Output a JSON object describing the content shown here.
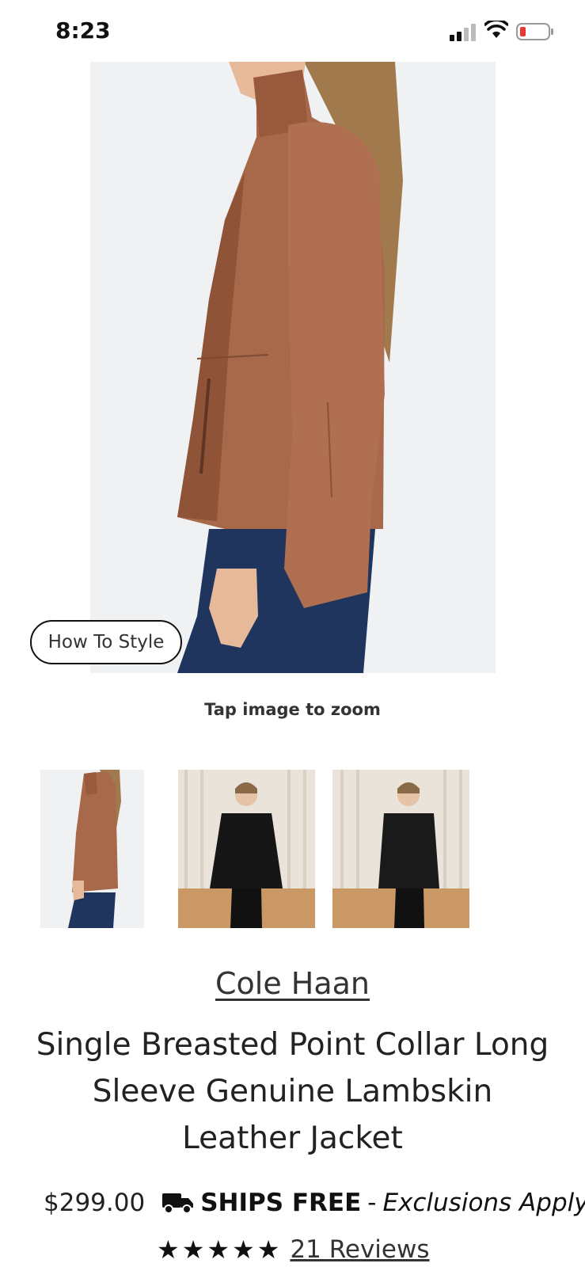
{
  "status": {
    "time": "8:23",
    "icons": [
      "signal-icon",
      "wifi-icon",
      "battery-icon"
    ]
  },
  "gallery": {
    "style_button": "How To Style",
    "zoom_hint": "Tap image to zoom",
    "thumbnail_count": 3
  },
  "product": {
    "brand": "Cole Haan",
    "title": "Single Breasted Point Collar Long Sleeve Genuine Lambskin Leather Jacket",
    "price": "$299.00",
    "shipping_bold": "SHIPS FREE",
    "shipping_dash": "-",
    "shipping_note": "Exclusions Apply",
    "rating_stars": "★★★★★",
    "reviews_label": "21 Reviews"
  },
  "colors": {
    "jacket": "#a8684a",
    "jeans": "#1f355e",
    "hero_bg": "#eff1f3"
  }
}
